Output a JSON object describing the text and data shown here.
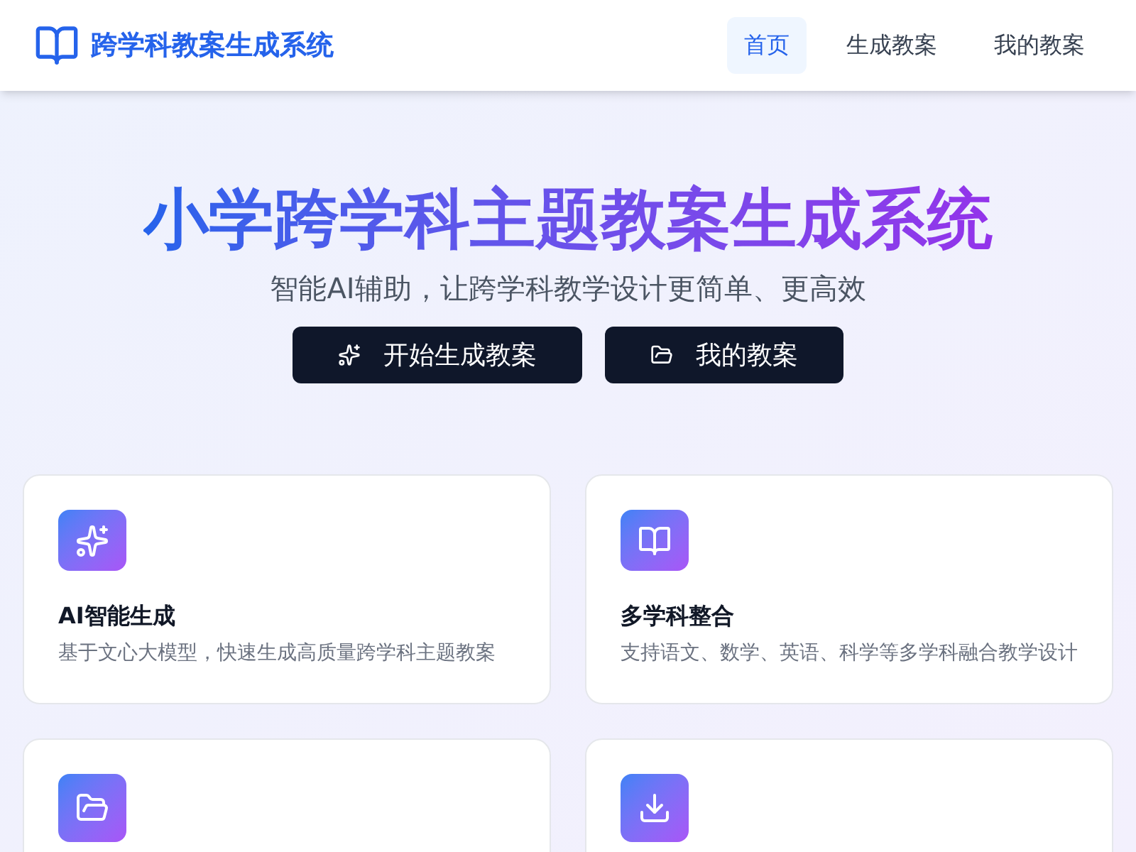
{
  "brand": {
    "name": "跨学科教案生成系统"
  },
  "nav": [
    {
      "label": "首页",
      "selected": true
    },
    {
      "label": "生成教案",
      "selected": false
    },
    {
      "label": "我的教案",
      "selected": false
    }
  ],
  "hero": {
    "title": "小学跨学科主题教案生成系统",
    "subtitle": "智能AI辅助，让跨学科教学设计更简单、更高效",
    "buttons": [
      {
        "label": "开始生成教案",
        "kind": "sparkles"
      },
      {
        "label": "我的教案",
        "kind": "folder"
      }
    ]
  },
  "features": [
    {
      "kind": "sparkles",
      "title": "AI智能生成",
      "description": "基于文心大模型，快速生成高质量跨学科主题教案"
    },
    {
      "kind": "book",
      "title": "多学科整合",
      "description": "支持语文、数学、英语、科学等多学科融合教学设计"
    },
    {
      "kind": "folder"
    },
    {
      "kind": "download"
    }
  ]
}
